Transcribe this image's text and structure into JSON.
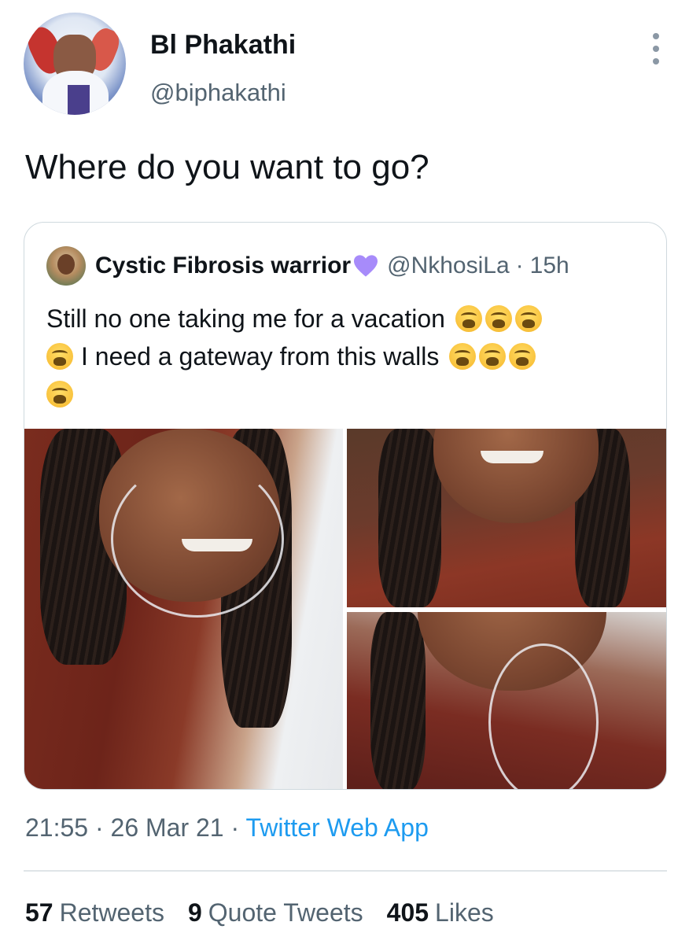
{
  "author": {
    "name": "Bl Phakathi",
    "handle": "@biphakathi"
  },
  "tweet": {
    "text": "Where do you want to go?",
    "time": "21:55",
    "date": "26 Mar 21",
    "source": "Twitter Web App",
    "separator": "·"
  },
  "quoted": {
    "name": "Cystic Fibrosis warrior",
    "heart_icon": "purple-heart-icon",
    "heart_color": "#a78bfa",
    "handle": "@NkhosiLa",
    "time": "15h",
    "line1": "Still no one taking me for a vacation",
    "line2": "I need a gateway from this walls",
    "emoji_name": "weary-face-icon",
    "emoji_count": 8
  },
  "stats": {
    "retweets_count": "57",
    "retweets_label": "Retweets",
    "quotes_count": "9",
    "quotes_label": "Quote Tweets",
    "likes_count": "405",
    "likes_label": "Likes"
  },
  "colors": {
    "link": "#1d9bf0",
    "secondary_text": "#536471",
    "primary_text": "#0f1419",
    "border": "#cfd9de"
  }
}
